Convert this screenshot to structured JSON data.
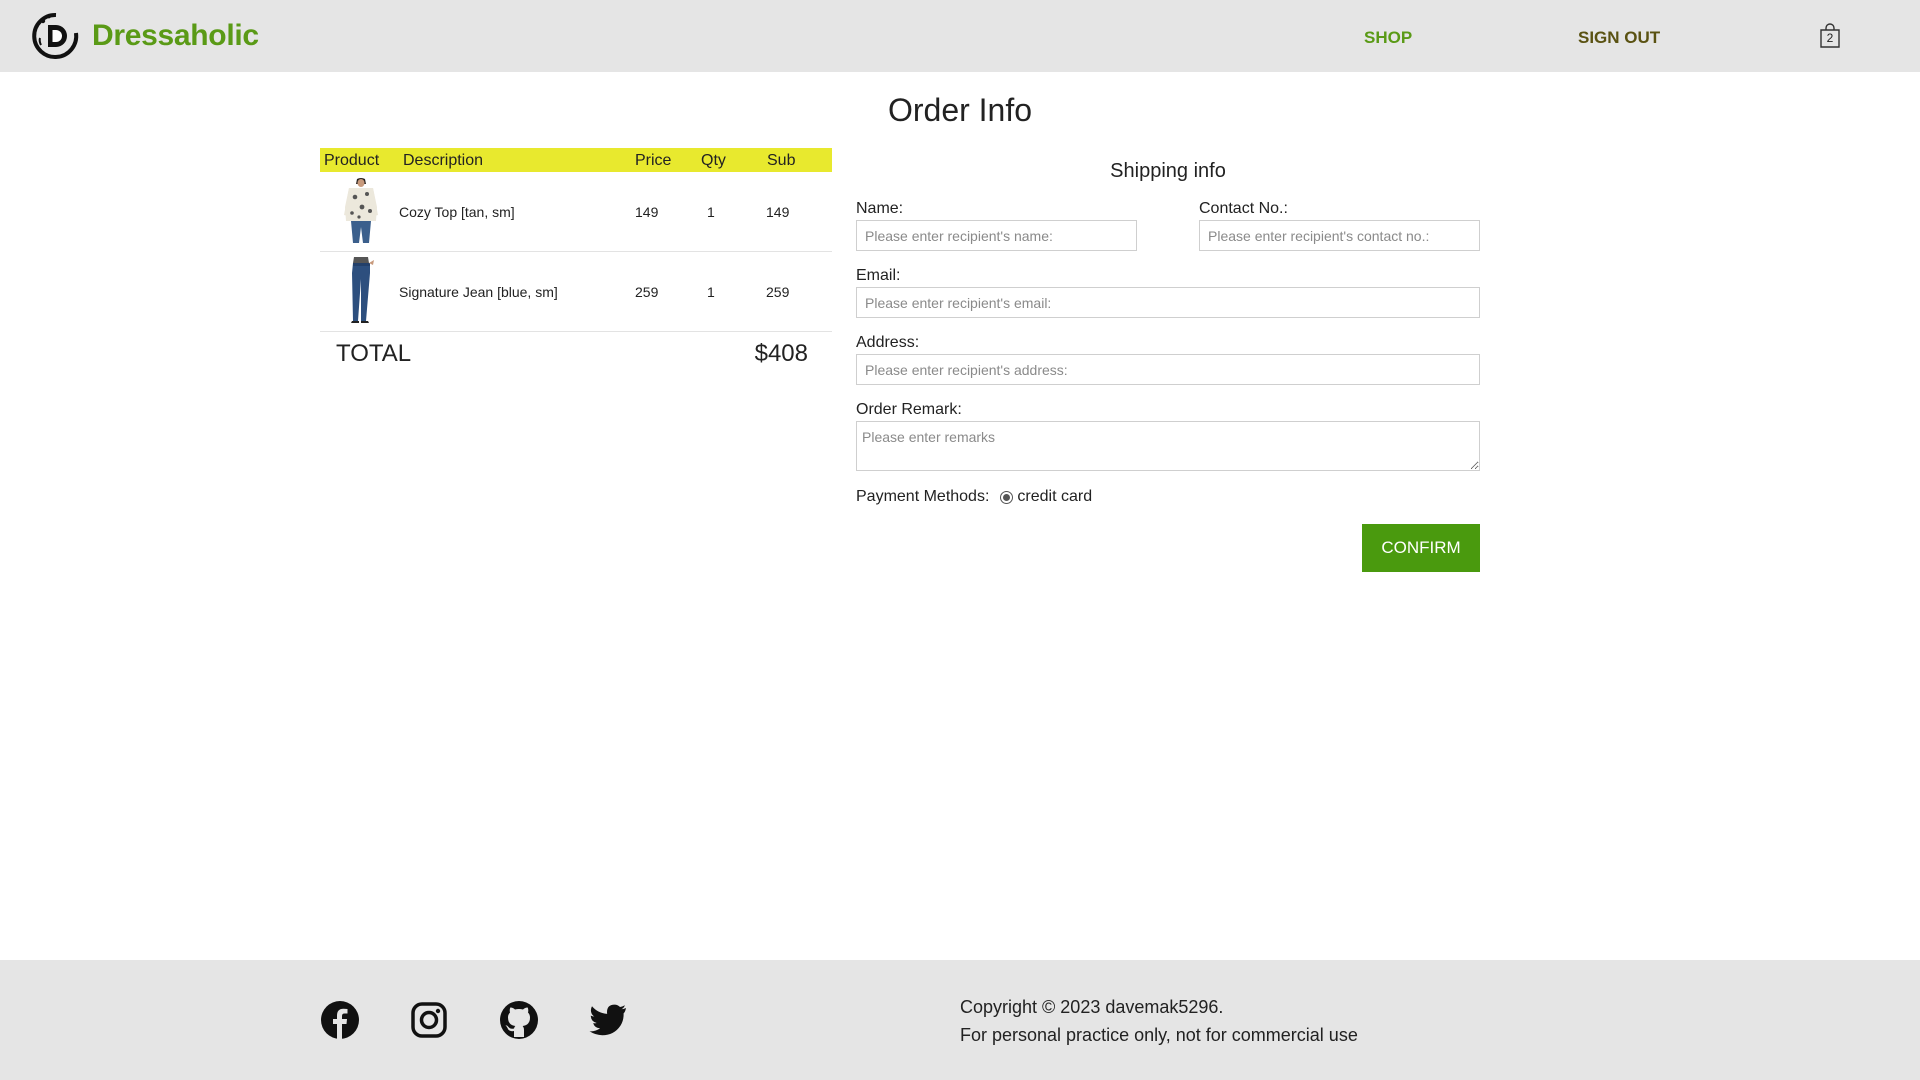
{
  "header": {
    "brand": "Dressaholic",
    "nav": {
      "shop": "SHOP",
      "sign_out": "SIGN OUT"
    },
    "cart_count": "2",
    "colors": {
      "brand": "#5a9a16",
      "signout": "#5a5212",
      "background": "#e5e5e5"
    }
  },
  "page_title": "Order Info",
  "order": {
    "columns": [
      "Product",
      "Description",
      "Price",
      "Qty",
      "Sub"
    ],
    "header_color": "#e8e92e",
    "items": [
      {
        "image": "cozy-top-thumbnail",
        "description": "Cozy Top [tan, sm]",
        "price": "149",
        "qty": "1",
        "sub": "149"
      },
      {
        "image": "signature-jean-thumbnail",
        "description": "Signature Jean [blue, sm]",
        "price": "259",
        "qty": "1",
        "sub": "259"
      }
    ],
    "total_label": "TOTAL",
    "total_value": "$408"
  },
  "shipping": {
    "title": "Shipping info",
    "name_label": "Name:",
    "name_placeholder": "Please enter recipient's name:",
    "name_value": "",
    "contact_label": "Contact No.:",
    "contact_placeholder": "Please enter recipient's contact no.:",
    "contact_value": "",
    "email_label": "Email:",
    "email_placeholder": "Please enter recipient's email:",
    "email_value": "",
    "address_label": "Address:",
    "address_placeholder": "Please enter recipient's address:",
    "address_value": "",
    "remark_label": "Order Remark:",
    "remark_placeholder": "Please enter remarks",
    "remark_value": "",
    "payment_label": "Payment Methods:",
    "payment_option": "credit card",
    "confirm_label": "CONFIRM",
    "confirm_color": "#4a9a0e"
  },
  "footer": {
    "social_icons": [
      "facebook-icon",
      "instagram-icon",
      "github-icon",
      "twitter-icon"
    ],
    "copyright": "Copyright © 2023 davemak5296.",
    "notice": "For personal practice only, not for commercial use"
  }
}
